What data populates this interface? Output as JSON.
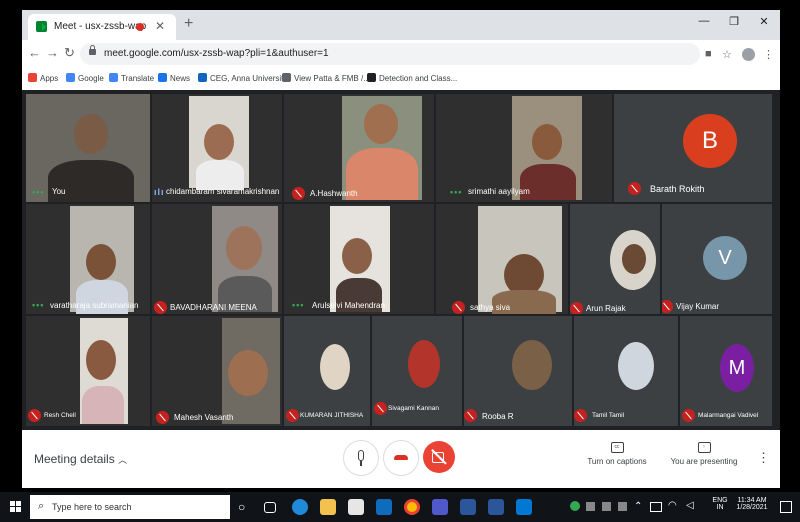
{
  "browser": {
    "tab_title": "Meet - usx-zssb-wap",
    "url": "meet.google.com/usx-zssb-wap?pli=1&authuser=1",
    "bookmarks": [
      {
        "label": "Apps",
        "color": "#ea4335"
      },
      {
        "label": "Google",
        "color": "#4285f4"
      },
      {
        "label": "Translate",
        "color": "#4285f4"
      },
      {
        "label": "News",
        "color": "#1a73e8"
      },
      {
        "label": "CEG, Anna Universit...",
        "color": "#1565c0"
      },
      {
        "label": "View Patta & FMB /...",
        "color": "#5f6368"
      },
      {
        "label": "Detection and Class...",
        "color": "#202124"
      }
    ]
  },
  "participants": {
    "you": "You",
    "chidambaram": "chidambaram sivaramakrishnan",
    "hashwanth": "A.Hashwanth",
    "srimathi": "srimathi aayilyam",
    "barath": "Barath Rokith",
    "barath_initial": "B",
    "varatharaja": "varatharaja subramanian",
    "bavadharani": "BAVADHARANI MEENA",
    "arulselvi": "Arulselvi Mahendran",
    "sathya": "sathya siva",
    "arun": "Arun Rajak",
    "vijay": "Vijay Kumar",
    "vijay_initial": "V",
    "resh": "Resh Chell",
    "mahesh": "Mahesh Vasanth",
    "kumaran": "KUMARAN JITHISHA",
    "sivagami": "Sivagami Kannan",
    "rooba": "Rooba R",
    "tamil": "Tamil Tamil",
    "malar": "Malarmangai Vadivel",
    "malar_initial": "M"
  },
  "bottom_bar": {
    "meeting_details": "Meeting details",
    "captions": "Turn on captions",
    "presenting": "You are presenting"
  },
  "taskbar": {
    "search_placeholder": "Type here to search",
    "lang1": "ENG",
    "lang2": "IN",
    "time": "11:34 AM",
    "date": "1/28/2021"
  }
}
